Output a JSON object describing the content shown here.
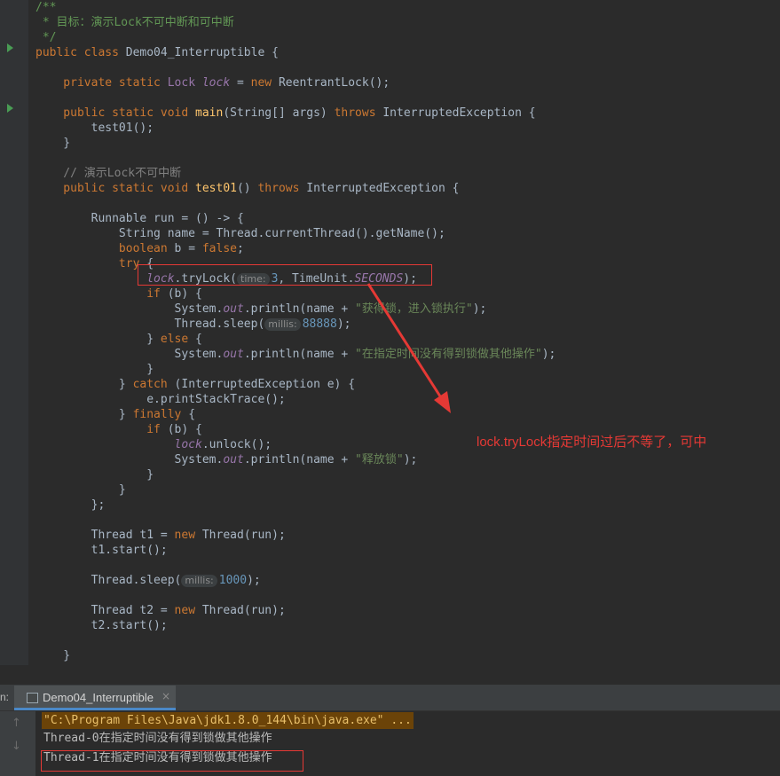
{
  "code": [
    [
      {
        "c": "doc",
        "t": "/**"
      }
    ],
    [
      {
        "c": "doc",
        "t": " * 目标：演示Lock不可中断和可中断"
      }
    ],
    [
      {
        "c": "doc",
        "t": " */"
      }
    ],
    [
      {
        "c": "kw",
        "t": "public class "
      },
      {
        "c": "",
        "t": "Demo04_Interruptible {"
      }
    ],
    [],
    [
      {
        "c": "kw",
        "t": "    private static "
      },
      {
        "c": "cls",
        "t": "Lock "
      },
      {
        "c": "fld",
        "t": "lock"
      },
      {
        "c": "",
        "t": " = "
      },
      {
        "c": "kw",
        "t": "new "
      },
      {
        "c": "",
        "t": "ReentrantLock();"
      }
    ],
    [],
    [
      {
        "c": "kw",
        "t": "    public static void "
      },
      {
        "c": "mth",
        "t": "main"
      },
      {
        "c": "",
        "t": "(String[] args) "
      },
      {
        "c": "kw",
        "t": "throws "
      },
      {
        "c": "",
        "t": "InterruptedException {"
      }
    ],
    [
      {
        "c": "",
        "t": "        test01();"
      }
    ],
    [
      {
        "c": "",
        "t": "    }"
      }
    ],
    [],
    [
      {
        "c": "cm",
        "t": "    // 演示Lock不可中断"
      }
    ],
    [
      {
        "c": "kw",
        "t": "    public static void "
      },
      {
        "c": "mth",
        "t": "test01"
      },
      {
        "c": "",
        "t": "() "
      },
      {
        "c": "kw",
        "t": "throws "
      },
      {
        "c": "",
        "t": "InterruptedException {"
      }
    ],
    [],
    [
      {
        "c": "",
        "t": "        Runnable run = () -> {"
      }
    ],
    [
      {
        "c": "",
        "t": "            String name = Thread."
      },
      {
        "c": "",
        "t": "currentThread().getName();"
      }
    ],
    [
      {
        "c": "kw",
        "t": "            boolean "
      },
      {
        "c": "",
        "t": "b = "
      },
      {
        "c": "kw",
        "t": "false"
      },
      {
        "c": "",
        "t": ";"
      }
    ],
    [
      {
        "c": "kw",
        "t": "            try "
      },
      {
        "c": "",
        "t": "{"
      }
    ],
    [
      {
        "c": "fld",
        "t": "                lock"
      },
      {
        "c": "",
        "t": ".tryLock("
      },
      {
        "c": "hint",
        "t": "time:"
      },
      {
        "c": "num",
        "t": "3"
      },
      {
        "c": "",
        "t": ", TimeUnit."
      },
      {
        "c": "fld",
        "t": "SECONDS"
      },
      {
        "c": "",
        "t": ");"
      }
    ],
    [
      {
        "c": "kw",
        "t": "                if "
      },
      {
        "c": "",
        "t": "(b) {"
      }
    ],
    [
      {
        "c": "",
        "t": "                    System."
      },
      {
        "c": "fld",
        "t": "out"
      },
      {
        "c": "",
        "t": ".println(name + "
      },
      {
        "c": "str",
        "t": "\"获得锁，进入锁执行\""
      },
      {
        "c": "",
        "t": ");"
      }
    ],
    [
      {
        "c": "",
        "t": "                    Thread."
      },
      {
        "c": "",
        "t": "sleep("
      },
      {
        "c": "hint",
        "t": "millis:"
      },
      {
        "c": "num",
        "t": "88888"
      },
      {
        "c": "",
        "t": ");"
      }
    ],
    [
      {
        "c": "",
        "t": "                } "
      },
      {
        "c": "kw",
        "t": "else "
      },
      {
        "c": "",
        "t": "{"
      }
    ],
    [
      {
        "c": "",
        "t": "                    System."
      },
      {
        "c": "fld",
        "t": "out"
      },
      {
        "c": "",
        "t": ".println(name + "
      },
      {
        "c": "str",
        "t": "\"在指定时间没有得到锁做其他操作\""
      },
      {
        "c": "",
        "t": ");"
      }
    ],
    [
      {
        "c": "",
        "t": "                }"
      }
    ],
    [
      {
        "c": "",
        "t": "            } "
      },
      {
        "c": "kw",
        "t": "catch "
      },
      {
        "c": "",
        "t": "(InterruptedException e) {"
      }
    ],
    [
      {
        "c": "",
        "t": "                e.printStackTrace();"
      }
    ],
    [
      {
        "c": "",
        "t": "            } "
      },
      {
        "c": "kw",
        "t": "finally "
      },
      {
        "c": "",
        "t": "{"
      }
    ],
    [
      {
        "c": "kw",
        "t": "                if "
      },
      {
        "c": "",
        "t": "(b) {"
      }
    ],
    [
      {
        "c": "fld",
        "t": "                    lock"
      },
      {
        "c": "",
        "t": ".unlock();"
      }
    ],
    [
      {
        "c": "",
        "t": "                    System."
      },
      {
        "c": "fld",
        "t": "out"
      },
      {
        "c": "",
        "t": ".println(name + "
      },
      {
        "c": "str",
        "t": "\"释放锁\""
      },
      {
        "c": "",
        "t": ");"
      }
    ],
    [
      {
        "c": "",
        "t": "                }"
      }
    ],
    [
      {
        "c": "",
        "t": "            }"
      }
    ],
    [
      {
        "c": "",
        "t": "        };"
      }
    ],
    [],
    [
      {
        "c": "",
        "t": "        Thread t1 = "
      },
      {
        "c": "kw",
        "t": "new "
      },
      {
        "c": "",
        "t": "Thread(run);"
      }
    ],
    [
      {
        "c": "",
        "t": "        t1.start();"
      }
    ],
    [],
    [
      {
        "c": "",
        "t": "        Thread."
      },
      {
        "c": "",
        "t": "sleep("
      },
      {
        "c": "hint",
        "t": "millis:"
      },
      {
        "c": "num",
        "t": "1000"
      },
      {
        "c": "",
        "t": ");"
      }
    ],
    [],
    [
      {
        "c": "",
        "t": "        Thread t2 = "
      },
      {
        "c": "kw",
        "t": "new "
      },
      {
        "c": "",
        "t": "Thread(run);"
      }
    ],
    [
      {
        "c": "",
        "t": "        t2.start();"
      }
    ],
    [],
    [
      {
        "c": "",
        "t": "    }"
      }
    ]
  ],
  "annotation": "lock.tryLock指定时间过后不等了，可中",
  "run_panel": {
    "prefix": "n:",
    "tab_label": "Demo04_Interruptible",
    "close": "×"
  },
  "console": {
    "cmd": "\"C:\\Program Files\\Java\\jdk1.8.0_144\\bin\\java.exe\" ...",
    "line1": "Thread-0在指定时间没有得到锁做其他操作",
    "line2": "Thread-1在指定时间没有得到锁做其他操作"
  },
  "colors": {
    "accent_red": "#e53935",
    "editor_bg": "#2b2b2b"
  }
}
